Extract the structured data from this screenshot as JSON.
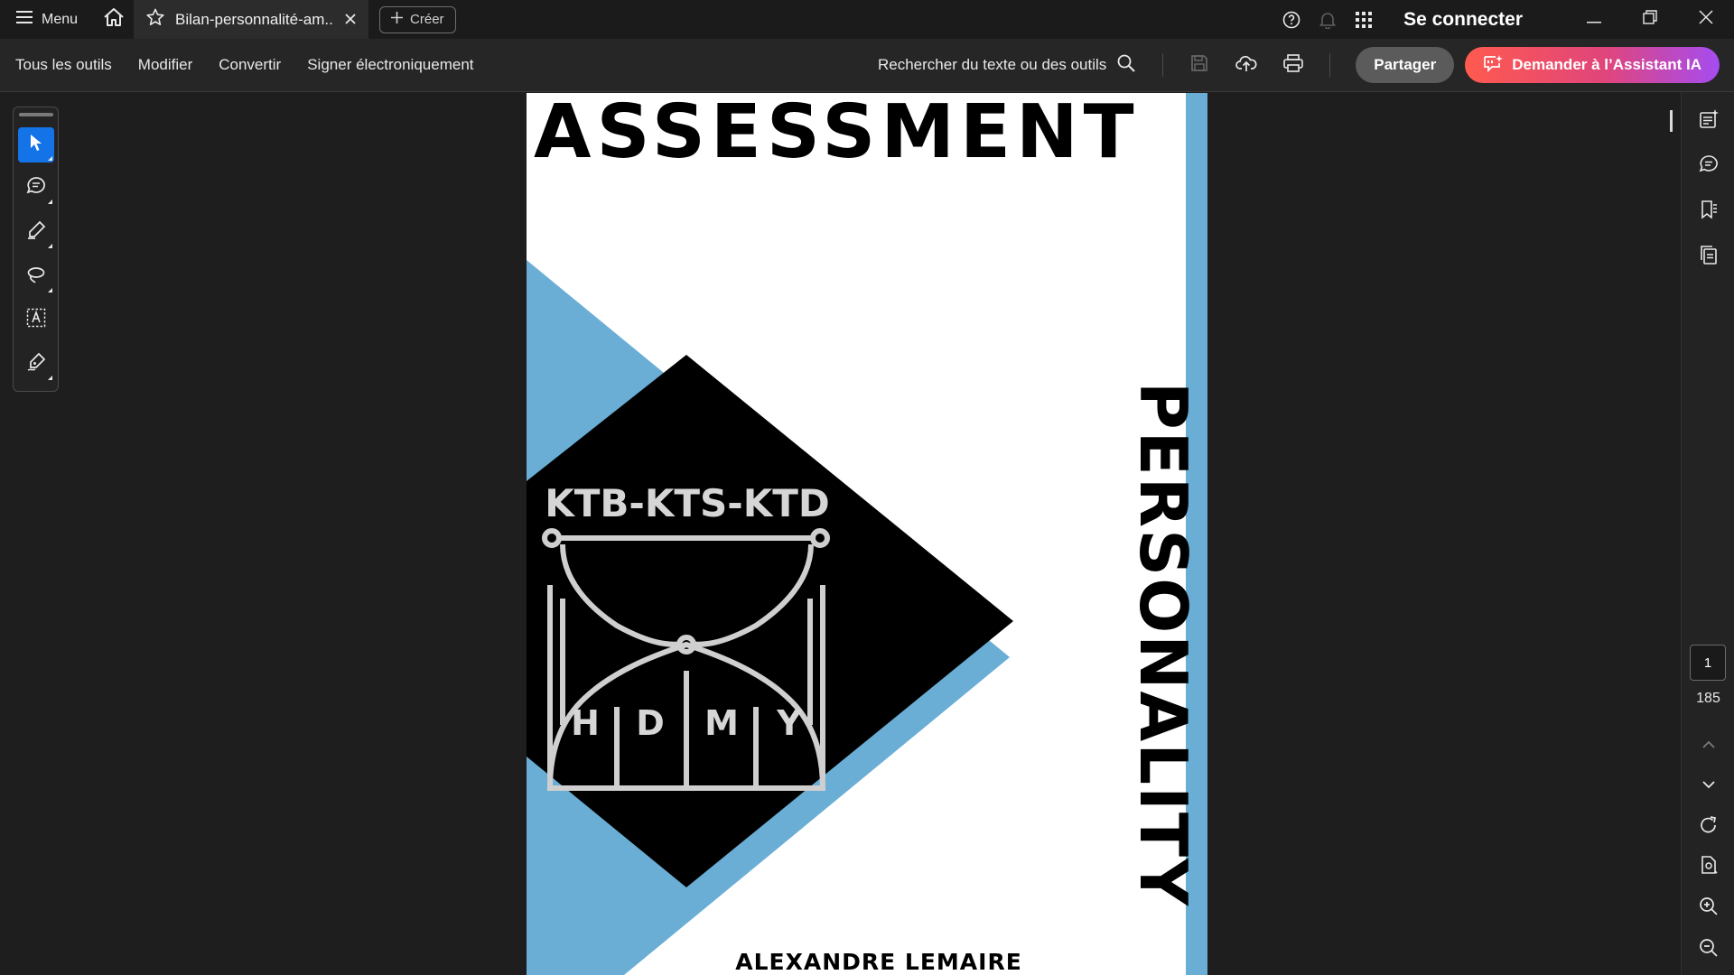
{
  "titlebar": {
    "menu_label": "Menu",
    "tab_title": "Bilan-personnalité-am...",
    "create_label": "Créer",
    "signin_label": "Se connecter"
  },
  "toolbar": {
    "items": [
      "Tous les outils",
      "Modifier",
      "Convertir",
      "Signer électroniquement"
    ],
    "search_label": "Rechercher du texte ou des outils",
    "share_label": "Partager",
    "ai_label": "Demander à l’Assistant IA"
  },
  "left_tools": [
    "select-tool",
    "comment-tool",
    "highlight-tool",
    "draw-tool",
    "text-select-tool",
    "sign-tool"
  ],
  "document": {
    "title_top": "ASSESSMENT",
    "title_side": "PERSONALITY",
    "logo_text": "KTB-KTS-KTD",
    "logo_letters": [
      "H",
      "D",
      "M",
      "Y"
    ],
    "author": "ALEXANDRE LEMAIRE",
    "colors": {
      "accent_blue": "#6aaed6",
      "diamond": "#000000",
      "page": "#ffffff"
    }
  },
  "navigation": {
    "current_page": "1",
    "total_pages": "185"
  },
  "colors": {
    "primary_blue": "#1473e6",
    "ai_gradient_start": "#ff5a4f",
    "ai_gradient_end": "#a54cf1"
  }
}
